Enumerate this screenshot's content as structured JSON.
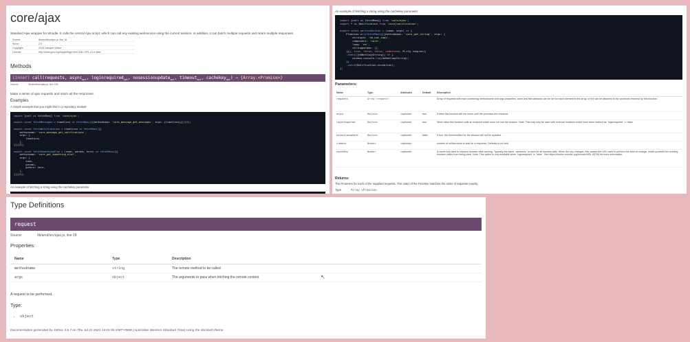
{
  "left": {
    "title": "core/ajax",
    "description": "Standard Ajax wrapper for Moodle. It calls the central Ajax script, which can call any existing webservice using the current session. In addition, it can batch multiple requests and return multiple responses.",
    "meta": [
      {
        "k": "Source:",
        "v": "lib/amd/src/ajax.js, line 16"
      },
      {
        "k": "Since:",
        "v": "2.9"
      },
      {
        "k": "Copyright:",
        "v": "2015 Damyon Wiese"
      },
      {
        "k": "License:",
        "v": "http://www.gnu.org/copyleft/gpl.html GNU GPL v3 or later"
      }
    ],
    "methods_heading": "Methods",
    "signature": {
      "prefix": "(inner) ",
      "name": "call",
      "args": "(requests, async",
      "args2": ", loginrequired",
      "args3": ", nosessionupdate",
      "args4": ", timeout",
      "args5": ", cachekey",
      "args6": ")",
      "opt": "opt",
      "arrow": " → {Array.<Promise>}"
    },
    "source_label": "Source:",
    "source_value": "lib/amd/src/ajax.js, line 226",
    "method_desc": "Make a series of ajax requests and return all the responses.",
    "examples_heading": "Examples",
    "example1_caption": "A simple example that you might find in a repository module",
    "example2_caption": "An example of fetching a string using the cachekey parameter"
  },
  "right": {
    "example_caption": "An example of fetching a string using the cachekey parameter",
    "params_heading": "Parameters:",
    "param_headers": [
      "Name",
      "Type",
      "Attributes",
      "Default",
      "Description"
    ],
    "params": [
      {
        "name": "requests",
        "type": "Array.<request>",
        "attr": "",
        "def": "",
        "desc": "Array of requests with each containing methodname and args properties. done and fail callbacks can be set for each element in the array, or the can be attached to the promises returned by this function."
      },
      {
        "name": "async",
        "type": "Boolean",
        "attr": "<optional>",
        "def": "true",
        "desc": "If false this function will not return until the promises are resolved."
      },
      {
        "name": "loginrequired",
        "type": "Boolean",
        "attr": "<optional>",
        "def": "true",
        "desc": "When false this function calls an endpoint which does not use the session. Note: This may only be used with external functions which have been marked as `loginrequired` => false"
      },
      {
        "name": "nosessionupdate",
        "type": "Boolean",
        "attr": "<optional>",
        "def": "false",
        "desc": "If true, the timemodified for the session will not be updated."
      },
      {
        "name": "timeout",
        "type": "Number",
        "attr": "<optional>",
        "def": "",
        "desc": "number of milliseconds to wait for a response. Defaults to no limit."
      },
      {
        "name": "cachekey",
        "type": "Number",
        "attr": "<optional>",
        "def": "",
        "desc": "A cache key used to improve browser-side caching. Typically the same `cachekey` is used for all function calls. When the key changes, this causes the URL used to perform the fetch to change, which prevents the existing browser cache from being used. Note: This option is only available when `loginrequired` is `false`. See https://tracker.moodle.org/browse/MDL-65794 for more information."
      }
    ],
    "returns_heading": "Returns:",
    "returns_desc": "The Promises for each of the supplied requests. The order of the Promise matches the order of requests exactly.",
    "returns_type_label": "Type",
    "returns_type_value": "Array.<Promise>"
  },
  "bottom": {
    "heading": "Type Definitions",
    "typedef_name": "request",
    "source_label": "Source:",
    "source_value": "lib/amd/src/ajax.js, line 28",
    "props_heading": "Properties:",
    "prop_headers": [
      "Name",
      "Type",
      "Description"
    ],
    "props": [
      {
        "name": "methodname",
        "type": "string",
        "desc": "The remote method to be called"
      },
      {
        "name": "args",
        "type": "object",
        "desc": "The arguments to pass when fetching the remote content"
      }
    ],
    "typedef_desc": "A request to be performed.",
    "type_heading": "Type:",
    "type_value": "object",
    "footer": "Documentation generated by JSDoc 3.6.7 on Thu Jul 22 2021 16:01:55 GMT+0800 (Australian Western Standard Time) using the docdash theme."
  }
}
